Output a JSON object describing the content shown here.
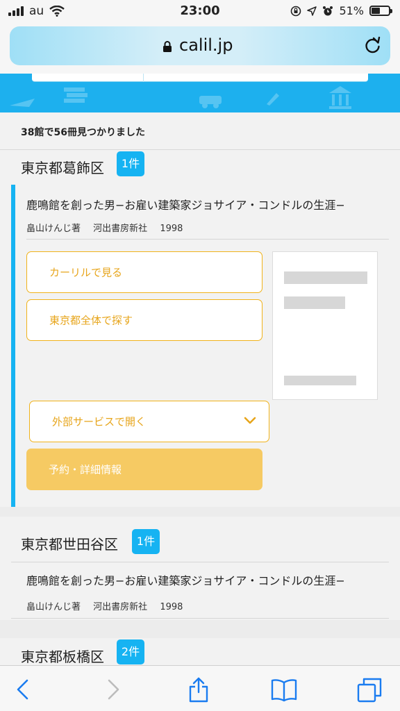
{
  "status_bar": {
    "carrier": "au",
    "time": "23:00",
    "battery": "51%",
    "battery_level": 0.51
  },
  "browser": {
    "url": "calil.jp"
  },
  "results": {
    "summary": "38館で56冊見つかりました"
  },
  "libraries": [
    {
      "ward": "東京都葛飾区",
      "count": "1件",
      "book": {
        "title": "鹿鳴館を創った男−お雇い建築家ジョサイア・コンドルの生涯−",
        "author": "畠山けんじ著",
        "publisher": "河出書房新社",
        "year": "1998"
      },
      "buttons": {
        "view_calil": "カーリルで見る",
        "search_tokyo": "東京都全体で探す",
        "external": "外部サービスで開く",
        "reserve": "予約・詳細情報"
      }
    },
    {
      "ward": "東京都世田谷区",
      "count": "1件",
      "book": {
        "title": "鹿鳴館を創った男−お雇い建築家ジョサイア・コンドルの生涯−",
        "author": "畠山けんじ著",
        "publisher": "河出書房新社",
        "year": "1998"
      }
    },
    {
      "ward": "東京都板橋区",
      "count": "2件"
    }
  ],
  "colors": {
    "accent_blue": "#16b3f2",
    "button_orange": "#f0b21a",
    "button_filled": "#f6ca63",
    "ios_blue": "#1a7cf0"
  },
  "icons": {
    "toolbar": [
      "back-icon",
      "forward-icon",
      "share-icon",
      "bookmarks-icon",
      "tabs-icon"
    ]
  }
}
